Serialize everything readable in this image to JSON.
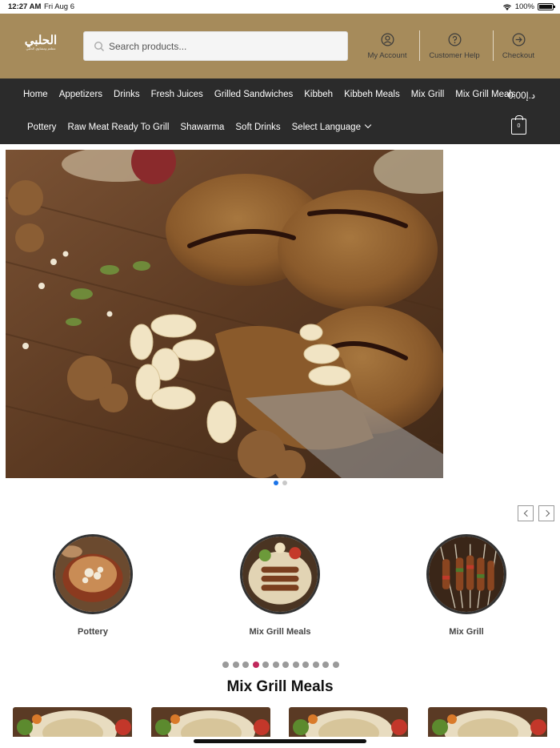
{
  "status": {
    "time": "12:27 AM",
    "date": "Fri Aug 6",
    "battery": "100%",
    "battery_level": 1.0
  },
  "logo": {
    "arabic": "الحلبي",
    "tagline": "مطعم ومشاوي الحلبي"
  },
  "search": {
    "placeholder": "Search products..."
  },
  "header_links": [
    {
      "label": "My Account",
      "icon": "user-circle-icon"
    },
    {
      "label": "Customer Help",
      "icon": "question-circle-icon"
    },
    {
      "label": "Checkout",
      "icon": "arrow-circle-icon"
    }
  ],
  "nav": {
    "row1": [
      "Home",
      "Appetizers",
      "Drinks",
      "Fresh Juices",
      "Grilled Sandwiches",
      "Kibbeh",
      "Kibbeh Meals",
      "Mix Grill",
      "Mix Grill Meals"
    ],
    "row2": [
      "Pottery",
      "Raw Meat Ready To Grill",
      "Shawarma",
      "Soft Drinks",
      "Select Language"
    ],
    "cart_total": "0.00د.إ",
    "cart_count": "0"
  },
  "hero": {
    "slides": 2,
    "active_slide": 1
  },
  "categories": [
    {
      "name": "Pottery"
    },
    {
      "name": "Mix Grill Meals"
    },
    {
      "name": "Mix Grill"
    }
  ],
  "category_pager": {
    "pages": 12,
    "active": 4
  },
  "section": {
    "title": "Mix Grill Meals"
  },
  "colors": {
    "header": "#a68b5b",
    "nav": "#2b2b2b",
    "accent_dot": "#c0285c",
    "hero_dot": "#1a73e8"
  }
}
